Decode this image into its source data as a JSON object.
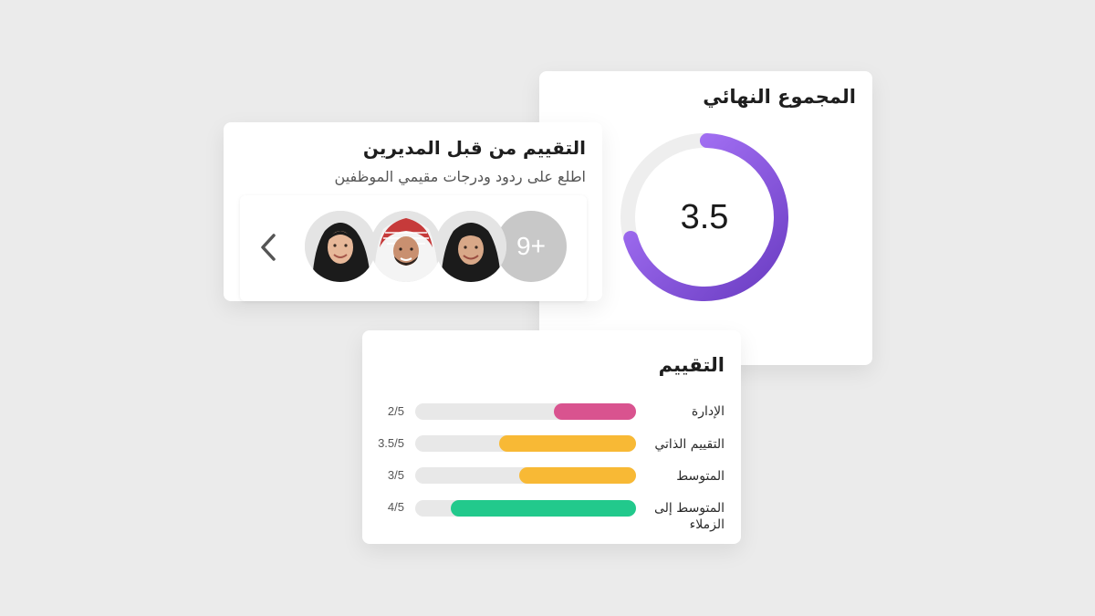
{
  "total": {
    "title": "المجموع النهائي",
    "value": "3.5",
    "value_fraction": 0.7,
    "ring_colors": {
      "start": "#a971ff",
      "end": "#6d3fc4",
      "track": "#eeeeee"
    }
  },
  "managers": {
    "title": "التقييم من قبل المديرين",
    "subtitle": "اطلع على ردود ودرجات مقيمي الموظفين",
    "more_label": "9+",
    "back_icon": "chevron-left-icon",
    "avatars": [
      "woman-in-black-hijab-avatar",
      "man-in-red-shemagh-avatar",
      "woman-in-black-hijab-avatar"
    ]
  },
  "rating": {
    "title": "التقييم",
    "rows": [
      {
        "label": "الإدارة",
        "score": "2/5",
        "fraction": 0.37,
        "color": "#d9538f"
      },
      {
        "label": "التقييم الذاتي",
        "score": "3.5/5",
        "fraction": 0.62,
        "color": "#f8b935"
      },
      {
        "label": "المتوسط",
        "score": "3/5",
        "fraction": 0.53,
        "color": "#f8b935"
      },
      {
        "label": "المتوسط إلى الزملاء",
        "score": "4/5",
        "fraction": 0.84,
        "color": "#22c98c"
      }
    ]
  }
}
